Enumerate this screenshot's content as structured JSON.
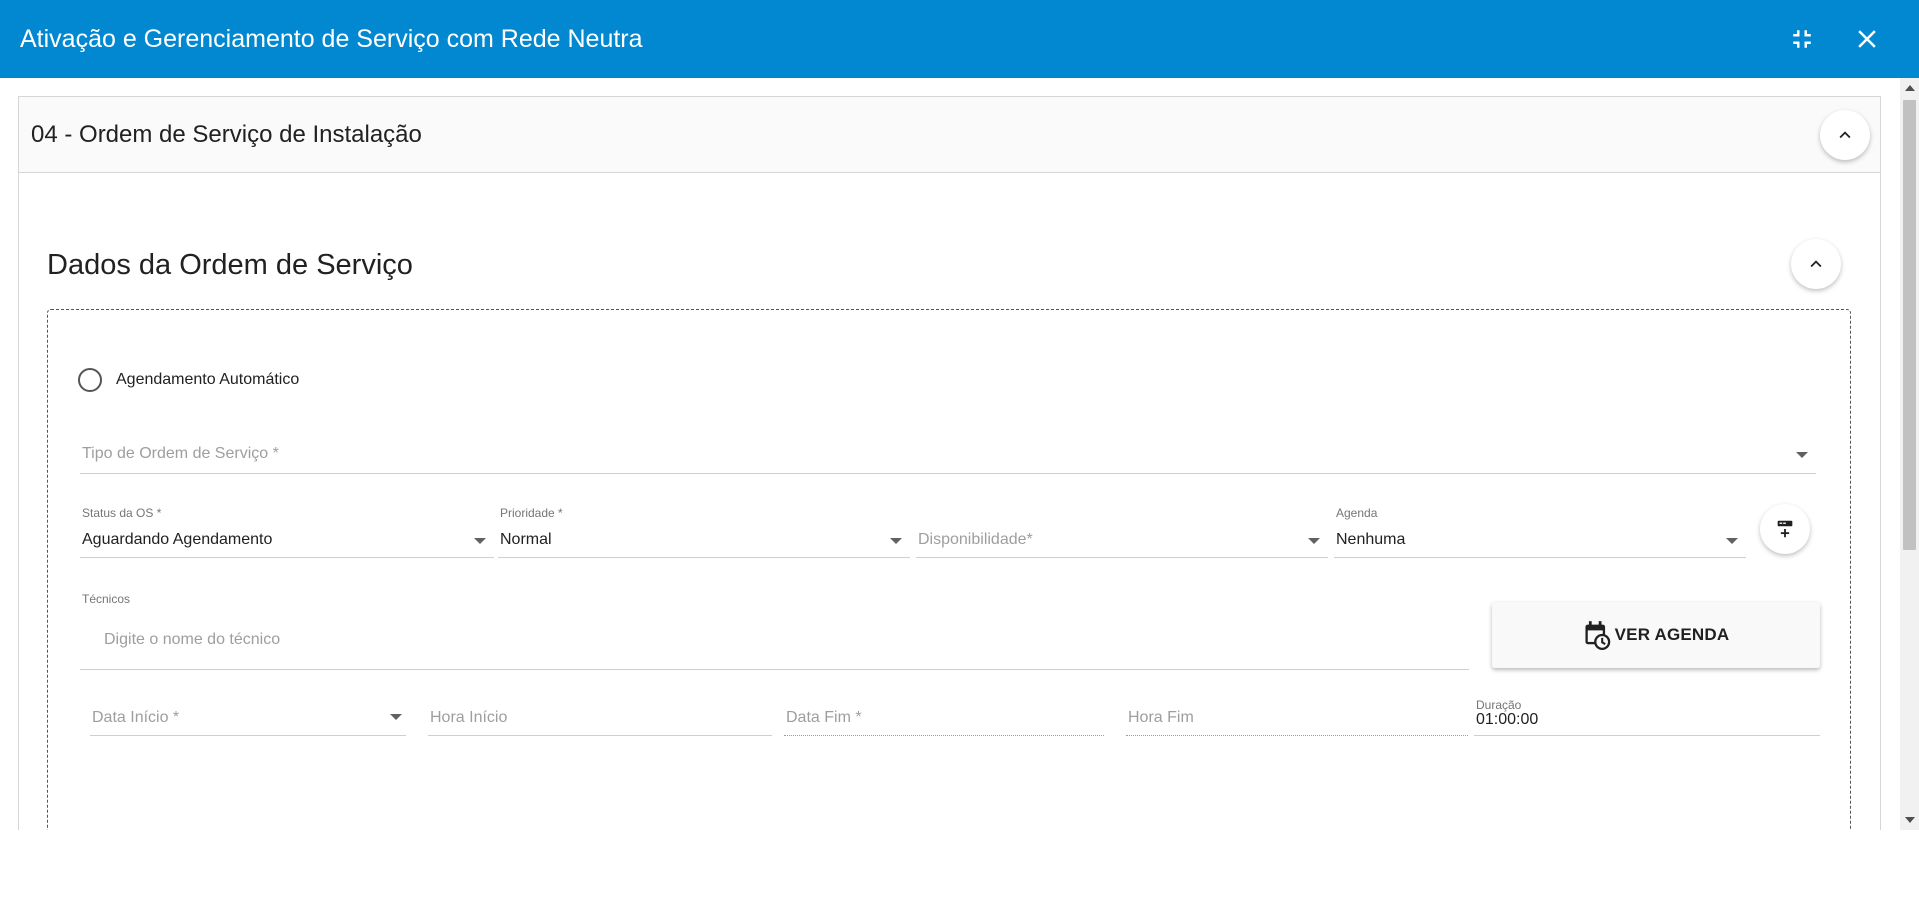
{
  "window": {
    "title": "Ativação e Gerenciamento de Serviço com Rede Neutra",
    "accent_color": "#0288d1",
    "icons": {
      "minimize": "fullscreen-exit-icon",
      "close": "close-icon"
    }
  },
  "panel": {
    "title": "04 - Ordem de Serviço de Instalação",
    "collapse_icon": "chevron-up-icon"
  },
  "section": {
    "title": "Dados da Ordem de Serviço",
    "collapse_icon": "chevron-up-icon"
  },
  "form": {
    "auto_schedule_label": "Agendamento Automático",
    "auto_schedule_checked": false,
    "tipo_os": {
      "placeholder": "Tipo de Ordem de Serviço *"
    },
    "status_os": {
      "label": "Status da OS *",
      "value": "Aguardando Agendamento"
    },
    "prioridade": {
      "label": "Prioridade *",
      "value": "Normal"
    },
    "disponibilidade": {
      "placeholder": "Disponibilidade*"
    },
    "agenda": {
      "label": "Agenda",
      "value": "Nenhuma"
    },
    "add_agenda_icon": "add-agenda-icon",
    "tecnicos": {
      "label": "Técnicos",
      "placeholder": "Digite o nome do técnico"
    },
    "ver_agenda": {
      "label": "VER AGENDA",
      "icon": "calendar-clock-icon"
    },
    "data_inicio": {
      "placeholder": "Data Início *"
    },
    "hora_inicio": {
      "placeholder": "Hora Início"
    },
    "data_fim": {
      "placeholder": "Data Fim *"
    },
    "hora_fim": {
      "placeholder": "Hora Fim"
    },
    "duracao": {
      "label": "Duração",
      "value": "01:00:00"
    }
  }
}
